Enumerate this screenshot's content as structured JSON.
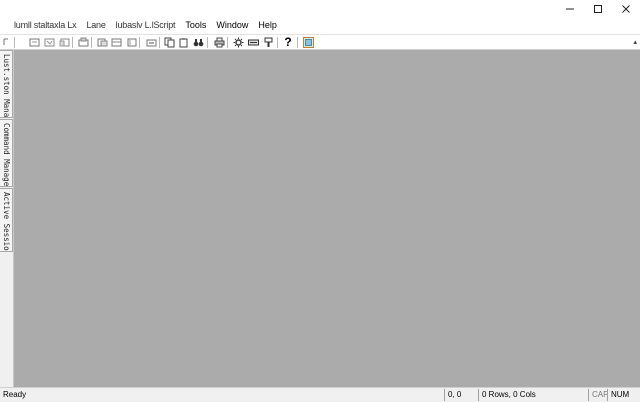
{
  "window": {
    "controls": {
      "minimize": "minimize-icon",
      "maximize": "maximize-icon",
      "close": "close-icon"
    }
  },
  "menu": {
    "items": [
      {
        "label": "lumll staltaxla Lx",
        "id": "menu-item-1"
      },
      {
        "label": "Lane",
        "id": "menu-item-2"
      },
      {
        "label": "lubaslv L.lScript",
        "id": "menu-item-3"
      },
      {
        "label": "Tools",
        "id": "menu-item-tools"
      },
      {
        "label": "Window",
        "id": "menu-item-window"
      },
      {
        "label": "Help",
        "id": "menu-item-help"
      }
    ]
  },
  "toolbar": {
    "buttons": [
      "toolbar-icon",
      "toolbar-icon",
      "toolbar-icon",
      "toolbar-icon",
      "toolbar-icon",
      "toolbar-icon",
      "toolbar-icon",
      "toolbar-icon",
      "toolbar-icon",
      "copy-icon",
      "paste-icon",
      "binoculars-icon",
      "print-icon",
      "settings-icon",
      "keyboard-icon",
      "brush-icon",
      "help-icon",
      "image-icon"
    ],
    "overflow_label": "▴"
  },
  "sidebar": {
    "tabs": [
      {
        "label": "Lust.ston Manager"
      },
      {
        "label": "Command Manager"
      },
      {
        "label": "Active Sessions"
      }
    ]
  },
  "statusbar": {
    "ready": "Ready",
    "position": "0, 0",
    "rows_cols": "0 Rows, 0 Cols",
    "caps": "CAP",
    "num": "NUM"
  },
  "colors": {
    "mdi_background": "#ababab",
    "chrome": "#f0f0f0",
    "help_icon": "#000000"
  }
}
